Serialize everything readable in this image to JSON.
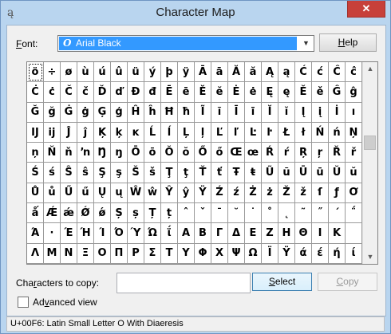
{
  "window": {
    "title": "Character Map",
    "close_glyph": "✕",
    "app_icon": "character-map-icon"
  },
  "font": {
    "label_pre": "",
    "label_u": "F",
    "label_post": "ont:",
    "selected": "Arial Black",
    "type_glyph": "O",
    "type_icon": "opentype-icon",
    "dropdown_icon": "chevron-down-icon"
  },
  "help_button": {
    "label_u": "H",
    "label_post": "elp"
  },
  "grid": {
    "selected_index": 0,
    "rows": [
      [
        "ö",
        "÷",
        "ø",
        "ù",
        "ú",
        "û",
        "ü",
        "ý",
        "þ",
        "ÿ",
        "Ā",
        "ā",
        "Ă",
        "ă",
        "Ą",
        "ą",
        "Ć",
        "ć",
        "Ĉ",
        "ĉ"
      ],
      [
        "Ċ",
        "ċ",
        "Č",
        "č",
        "Ď",
        "ď",
        "Đ",
        "đ",
        "Ē",
        "ē",
        "Ĕ",
        "ĕ",
        "Ė",
        "ė",
        "Ę",
        "ę",
        "Ě",
        "ě",
        "Ĝ",
        "ĝ"
      ],
      [
        "Ğ",
        "ğ",
        "Ġ",
        "ġ",
        "Ģ",
        "ģ",
        "Ĥ",
        "ĥ",
        "Ħ",
        "ħ",
        "Ĩ",
        "ĩ",
        "Ī",
        "ī",
        "Ĭ",
        "ĭ",
        "Į",
        "į",
        "İ",
        "ı"
      ],
      [
        "Ĳ",
        "ĳ",
        "Ĵ",
        "ĵ",
        "Ķ",
        "ķ",
        "ĸ",
        "Ĺ",
        "ĺ",
        "Ļ",
        "ļ",
        "Ľ",
        "ľ",
        "Ŀ",
        "ŀ",
        "Ł",
        "ł",
        "Ń",
        "ń",
        "Ņ"
      ],
      [
        "ņ",
        "Ň",
        "ň",
        "ŉ",
        "Ŋ",
        "ŋ",
        "Ō",
        "ō",
        "Ŏ",
        "ŏ",
        "Ő",
        "ő",
        "Œ",
        "œ",
        "Ŕ",
        "ŕ",
        "Ŗ",
        "ŗ",
        "Ř",
        "ř"
      ],
      [
        "Ś",
        "ś",
        "Ŝ",
        "ŝ",
        "Ş",
        "ş",
        "Š",
        "š",
        "Ţ",
        "ţ",
        "Ť",
        "ť",
        "Ŧ",
        "ŧ",
        "Ũ",
        "ũ",
        "Ū",
        "ū",
        "Ŭ",
        "ŭ"
      ],
      [
        "Ů",
        "ů",
        "Ű",
        "ű",
        "Ų",
        "ų",
        "Ŵ",
        "ŵ",
        "Ŷ",
        "ŷ",
        "Ÿ",
        "Ź",
        "ź",
        "Ż",
        "ż",
        "Ž",
        "ž",
        "ſ",
        "ƒ",
        "Ơ"
      ],
      [
        "ǻ",
        "Ǽ",
        "ǽ",
        "Ǿ",
        "ǿ",
        "Ș",
        "ș",
        "Ț",
        "ț",
        "ˆ",
        "ˇ",
        "ˉ",
        "˘",
        "˙",
        "˚",
        "˛",
        "˜",
        "˝",
        "΄",
        "΅"
      ],
      [
        "Ά",
        "·",
        "Έ",
        "Ή",
        "Ί",
        "Ό",
        "Ύ",
        "Ώ",
        "ΐ",
        "Α",
        "Β",
        "Γ",
        "Δ",
        "Ε",
        "Ζ",
        "Η",
        "Θ",
        "Ι",
        "Κ",
        ""
      ],
      [
        "Λ",
        "Μ",
        "Ν",
        "Ξ",
        "Ο",
        "Π",
        "Ρ",
        "Σ",
        "Τ",
        "Υ",
        "Φ",
        "Χ",
        "Ψ",
        "Ω",
        "Ϊ",
        "Ϋ",
        "ά",
        "έ",
        "ή",
        "ί"
      ]
    ]
  },
  "scrollbar": {
    "up_icon": "scroll-up-arrow-icon",
    "down_icon": "scroll-down-arrow-icon",
    "up_glyph": "▲",
    "down_glyph": "▼"
  },
  "copy": {
    "label_pre": "Cha",
    "label_u": "r",
    "label_post": "acters to copy:",
    "value": "",
    "select_u": "S",
    "select_post": "elect",
    "copy_u": "C",
    "copy_post": "opy"
  },
  "advanced": {
    "label_pre": "Ad",
    "label_u": "v",
    "label_post": "anced view",
    "checked": false
  },
  "status": {
    "text": "U+00F6: Latin Small Letter O With Diaeresis"
  }
}
